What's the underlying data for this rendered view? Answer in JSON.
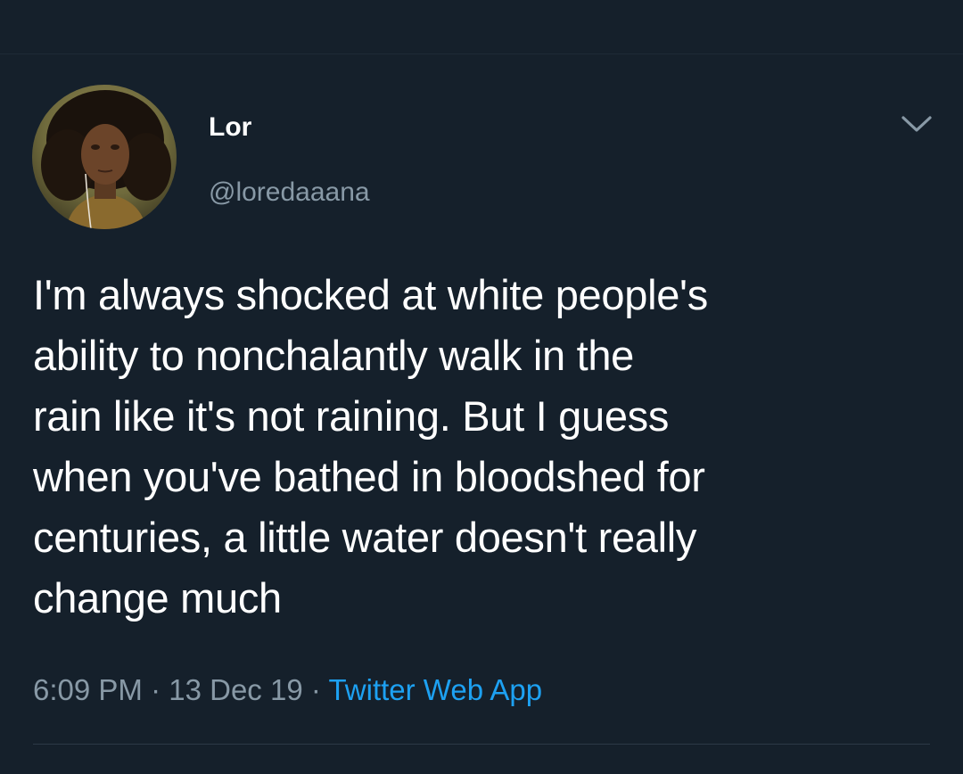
{
  "tweet": {
    "author": {
      "display_name": "Lor",
      "handle": "@loredaaana"
    },
    "text": "I'm always shocked at white people's\nability to nonchalantly walk in the\nrain like it's not raining. But I guess\nwhen you've bathed in bloodshed for\ncenturies, a little water doesn't really\nchange much",
    "time": "6:09 PM",
    "separator": "·",
    "date": "13 Dec 19",
    "source": "Twitter Web App"
  },
  "icons": {
    "menu": "chevron-down-icon",
    "avatar": "avatar"
  },
  "colors": {
    "background": "#15202b",
    "primary_text": "#ffffff",
    "secondary_text": "#8899a6",
    "link": "#1da1f2",
    "divider": "#2c3946"
  }
}
